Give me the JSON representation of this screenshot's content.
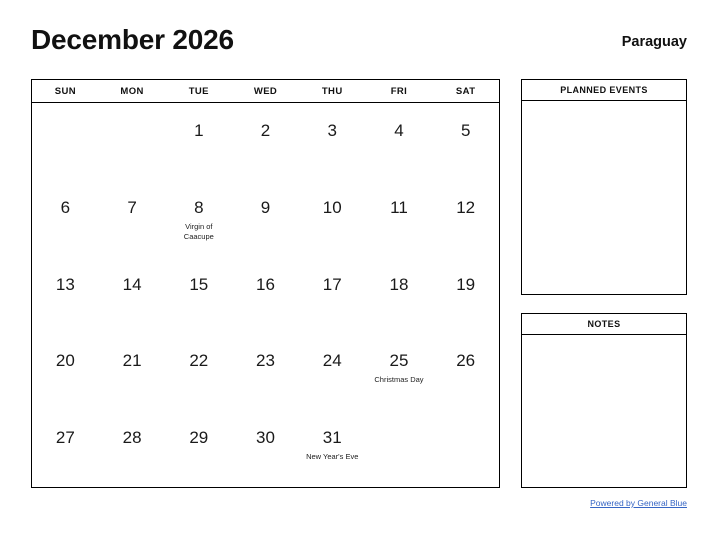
{
  "header": {
    "month_title": "December 2026",
    "country": "Paraguay"
  },
  "calendar": {
    "weekdays": [
      "SUN",
      "MON",
      "TUE",
      "WED",
      "THU",
      "FRI",
      "SAT"
    ],
    "weeks": [
      [
        {
          "day": "",
          "event": ""
        },
        {
          "day": "",
          "event": ""
        },
        {
          "day": "1",
          "event": ""
        },
        {
          "day": "2",
          "event": ""
        },
        {
          "day": "3",
          "event": ""
        },
        {
          "day": "4",
          "event": ""
        },
        {
          "day": "5",
          "event": ""
        }
      ],
      [
        {
          "day": "6",
          "event": ""
        },
        {
          "day": "7",
          "event": ""
        },
        {
          "day": "8",
          "event": "Virgin of Caacupe"
        },
        {
          "day": "9",
          "event": ""
        },
        {
          "day": "10",
          "event": ""
        },
        {
          "day": "11",
          "event": ""
        },
        {
          "day": "12",
          "event": ""
        }
      ],
      [
        {
          "day": "13",
          "event": ""
        },
        {
          "day": "14",
          "event": ""
        },
        {
          "day": "15",
          "event": ""
        },
        {
          "day": "16",
          "event": ""
        },
        {
          "day": "17",
          "event": ""
        },
        {
          "day": "18",
          "event": ""
        },
        {
          "day": "19",
          "event": ""
        }
      ],
      [
        {
          "day": "20",
          "event": ""
        },
        {
          "day": "21",
          "event": ""
        },
        {
          "day": "22",
          "event": ""
        },
        {
          "day": "23",
          "event": ""
        },
        {
          "day": "24",
          "event": ""
        },
        {
          "day": "25",
          "event": "Christmas Day"
        },
        {
          "day": "26",
          "event": ""
        }
      ],
      [
        {
          "day": "27",
          "event": ""
        },
        {
          "day": "28",
          "event": ""
        },
        {
          "day": "29",
          "event": ""
        },
        {
          "day": "30",
          "event": ""
        },
        {
          "day": "31",
          "event": "New Year's Eve"
        },
        {
          "day": "",
          "event": ""
        },
        {
          "day": "",
          "event": ""
        }
      ]
    ]
  },
  "panels": {
    "planned_events_title": "PLANNED EVENTS",
    "notes_title": "NOTES"
  },
  "footer": {
    "link_label": "Powered by General Blue",
    "link_color": "#3665c4"
  }
}
